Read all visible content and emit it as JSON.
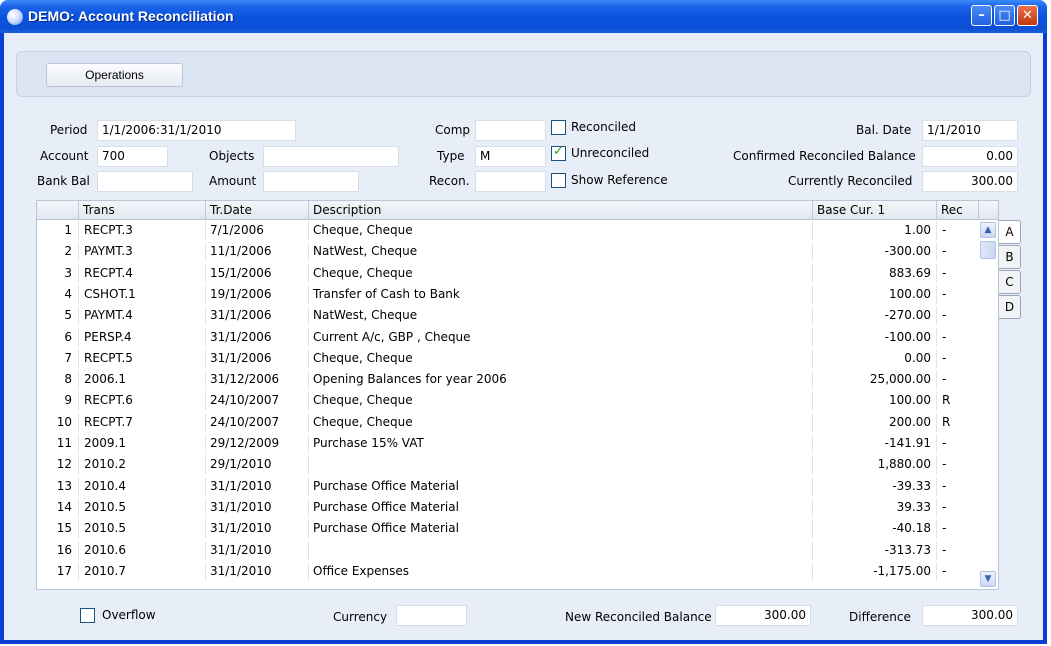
{
  "window": {
    "title": "DEMO: Account Reconciliation"
  },
  "toolbar": {
    "operations_label": "Operations"
  },
  "filters": {
    "period_label": "Period",
    "period_value": "1/1/2006:31/1/2010",
    "comp_label": "Comp",
    "comp_value": "",
    "bal_date_label": "Bal. Date",
    "bal_date_value": "1/1/2010",
    "account_label": "Account",
    "account_value": "700",
    "objects_label": "Objects",
    "objects_value": "",
    "type_label": "Type",
    "type_value": "M",
    "confirmed_label": "Confirmed Reconciled Balance",
    "confirmed_value": "0.00",
    "bank_bal_label": "Bank Bal",
    "bank_bal_value": "",
    "amount_label": "Amount",
    "amount_value": "",
    "recon_label": "Recon.",
    "recon_value": "",
    "currently_label": "Currently Reconciled",
    "currently_value": "300.00",
    "reconciled_label": "Reconciled",
    "reconciled_checked": false,
    "unreconciled_label": "Unreconciled",
    "unreconciled_checked": true,
    "show_reference_label": "Show Reference",
    "show_reference_checked": false
  },
  "table": {
    "columns": [
      "",
      "Trans",
      "Tr.Date",
      "Description",
      "Base Cur. 1",
      "Rec"
    ],
    "rows": [
      [
        "1",
        "RECPT.3",
        "7/1/2006",
        "Cheque, Cheque",
        "1.00",
        "-"
      ],
      [
        "2",
        "PAYMT.3",
        "11/1/2006",
        "NatWest, Cheque",
        "-300.00",
        "-"
      ],
      [
        "3",
        "RECPT.4",
        "15/1/2006",
        "Cheque, Cheque",
        "883.69",
        "-"
      ],
      [
        "4",
        "CSHOT.1",
        "19/1/2006",
        "Transfer of Cash to Bank",
        "100.00",
        "-"
      ],
      [
        "5",
        "PAYMT.4",
        "31/1/2006",
        "NatWest, Cheque",
        "-270.00",
        "-"
      ],
      [
        "6",
        "PERSP.4",
        "31/1/2006",
        "Current A/c, GBP , Cheque",
        "-100.00",
        "-"
      ],
      [
        "7",
        "RECPT.5",
        "31/1/2006",
        "Cheque, Cheque",
        "0.00",
        "-"
      ],
      [
        "8",
        "2006.1",
        "31/12/2006",
        "Opening Balances for year 2006",
        "25,000.00",
        "-"
      ],
      [
        "9",
        "RECPT.6",
        "24/10/2007",
        "Cheque, Cheque",
        "100.00",
        "R"
      ],
      [
        "10",
        "RECPT.7",
        "24/10/2007",
        "Cheque, Cheque",
        "200.00",
        "R"
      ],
      [
        "11",
        "2009.1",
        "29/12/2009",
        "Purchase 15% VAT",
        "-141.91",
        "-"
      ],
      [
        "12",
        "2010.2",
        "29/1/2010",
        "",
        "1,880.00",
        "-"
      ],
      [
        "13",
        "2010.4",
        "31/1/2010",
        "Purchase Office Material",
        "-39.33",
        "-"
      ],
      [
        "14",
        "2010.5",
        "31/1/2010",
        "Purchase Office Material",
        "39.33",
        "-"
      ],
      [
        "15",
        "2010.5",
        "31/1/2010",
        "Purchase Office Material",
        "-40.18",
        "-"
      ],
      [
        "16",
        "2010.6",
        "31/1/2010",
        "",
        "-313.73",
        "-"
      ],
      [
        "17",
        "2010.7",
        "31/1/2010",
        "Office Expenses",
        "-1,175.00",
        "-"
      ]
    ]
  },
  "tabs": [
    "A",
    "B",
    "C",
    "D"
  ],
  "active_tab": "A",
  "footer": {
    "overflow_label": "Overflow",
    "overflow_checked": false,
    "currency_label": "Currency",
    "currency_value": "",
    "new_balance_label": "New Reconciled Balance",
    "new_balance_value": "300.00",
    "difference_label": "Difference",
    "difference_value": "300.00"
  },
  "colors": {
    "title_bar": "#0a52de",
    "client_bg": "#e8eef7",
    "check_green": "#21a121"
  },
  "icons": [
    "app-icon",
    "minimize-icon",
    "maximize-icon",
    "close-icon",
    "scroll-up-icon",
    "scroll-down-icon"
  ]
}
